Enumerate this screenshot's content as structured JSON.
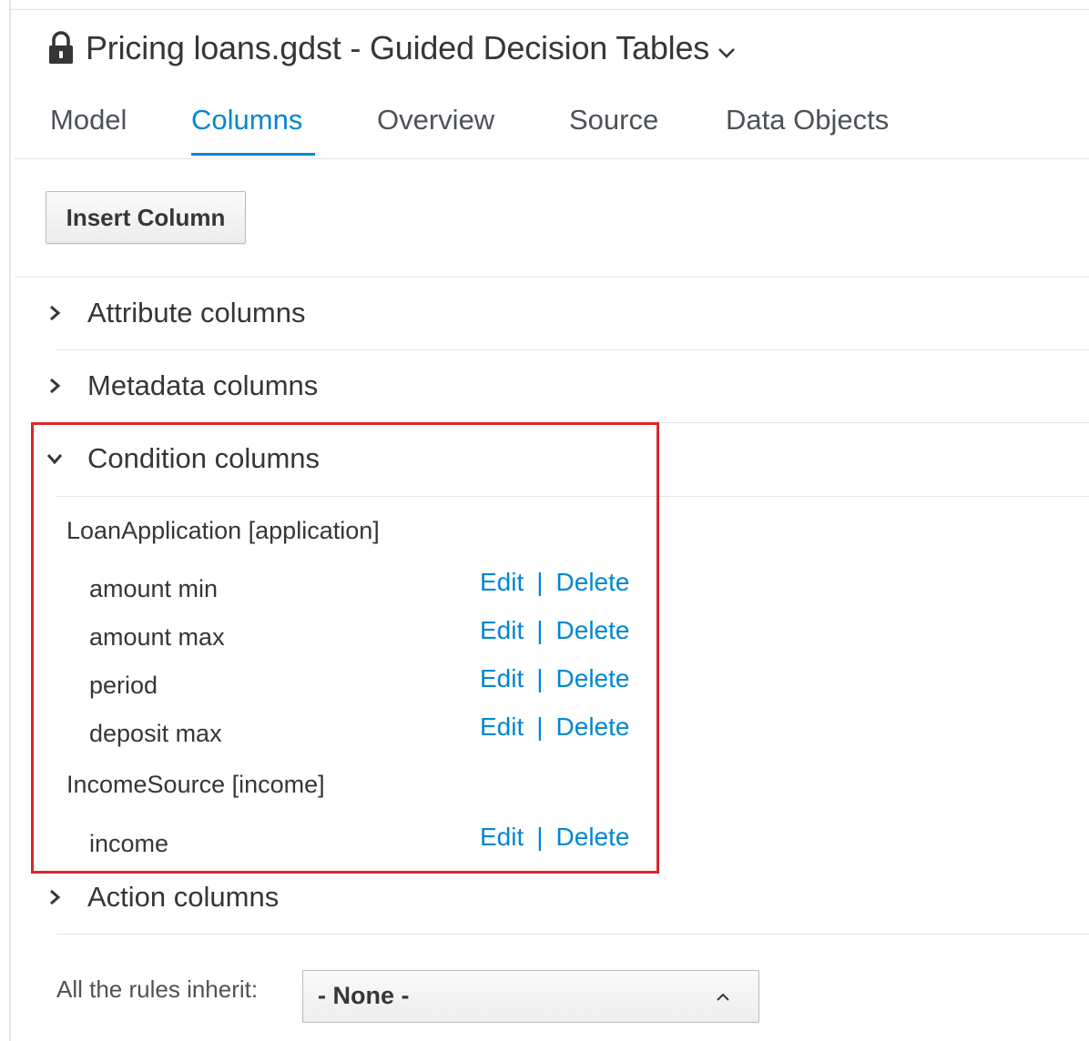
{
  "window": {
    "title": "Pricing loans.gdst - Guided Decision Tables",
    "lock_icon": "lock-icon",
    "title_caret_icon": "chevron-down-icon"
  },
  "tabs": [
    {
      "label": "Model",
      "active": false
    },
    {
      "label": "Columns",
      "active": true
    },
    {
      "label": "Overview",
      "active": false
    },
    {
      "label": "Source",
      "active": false
    },
    {
      "label": "Data Objects",
      "active": false
    }
  ],
  "toolbar": {
    "insert_column_label": "Insert Column"
  },
  "sections": {
    "attribute": {
      "label": "Attribute columns",
      "expanded": false
    },
    "metadata": {
      "label": "Metadata columns",
      "expanded": false
    },
    "condition": {
      "label": "Condition columns",
      "expanded": true
    },
    "action": {
      "label": "Action columns",
      "expanded": false
    }
  },
  "condition_columns": {
    "patterns": [
      {
        "label": "LoanApplication [application]",
        "columns": [
          {
            "name": "amount min",
            "edit_label": "Edit",
            "delete_label": "Delete"
          },
          {
            "name": "amount max",
            "edit_label": "Edit",
            "delete_label": "Delete"
          },
          {
            "name": "period",
            "edit_label": "Edit",
            "delete_label": "Delete"
          },
          {
            "name": "deposit max",
            "edit_label": "Edit",
            "delete_label": "Delete"
          }
        ]
      },
      {
        "label": "IncomeSource [income]",
        "columns": [
          {
            "name": "income",
            "edit_label": "Edit",
            "delete_label": "Delete"
          }
        ]
      }
    ],
    "separator": "|"
  },
  "inherit": {
    "label": "All the rules inherit:",
    "selected": "- None -"
  },
  "colors": {
    "accent": "#0088ce",
    "highlight_border": "#d9262b",
    "text": "#363636",
    "divider": "#e4e4e4"
  }
}
